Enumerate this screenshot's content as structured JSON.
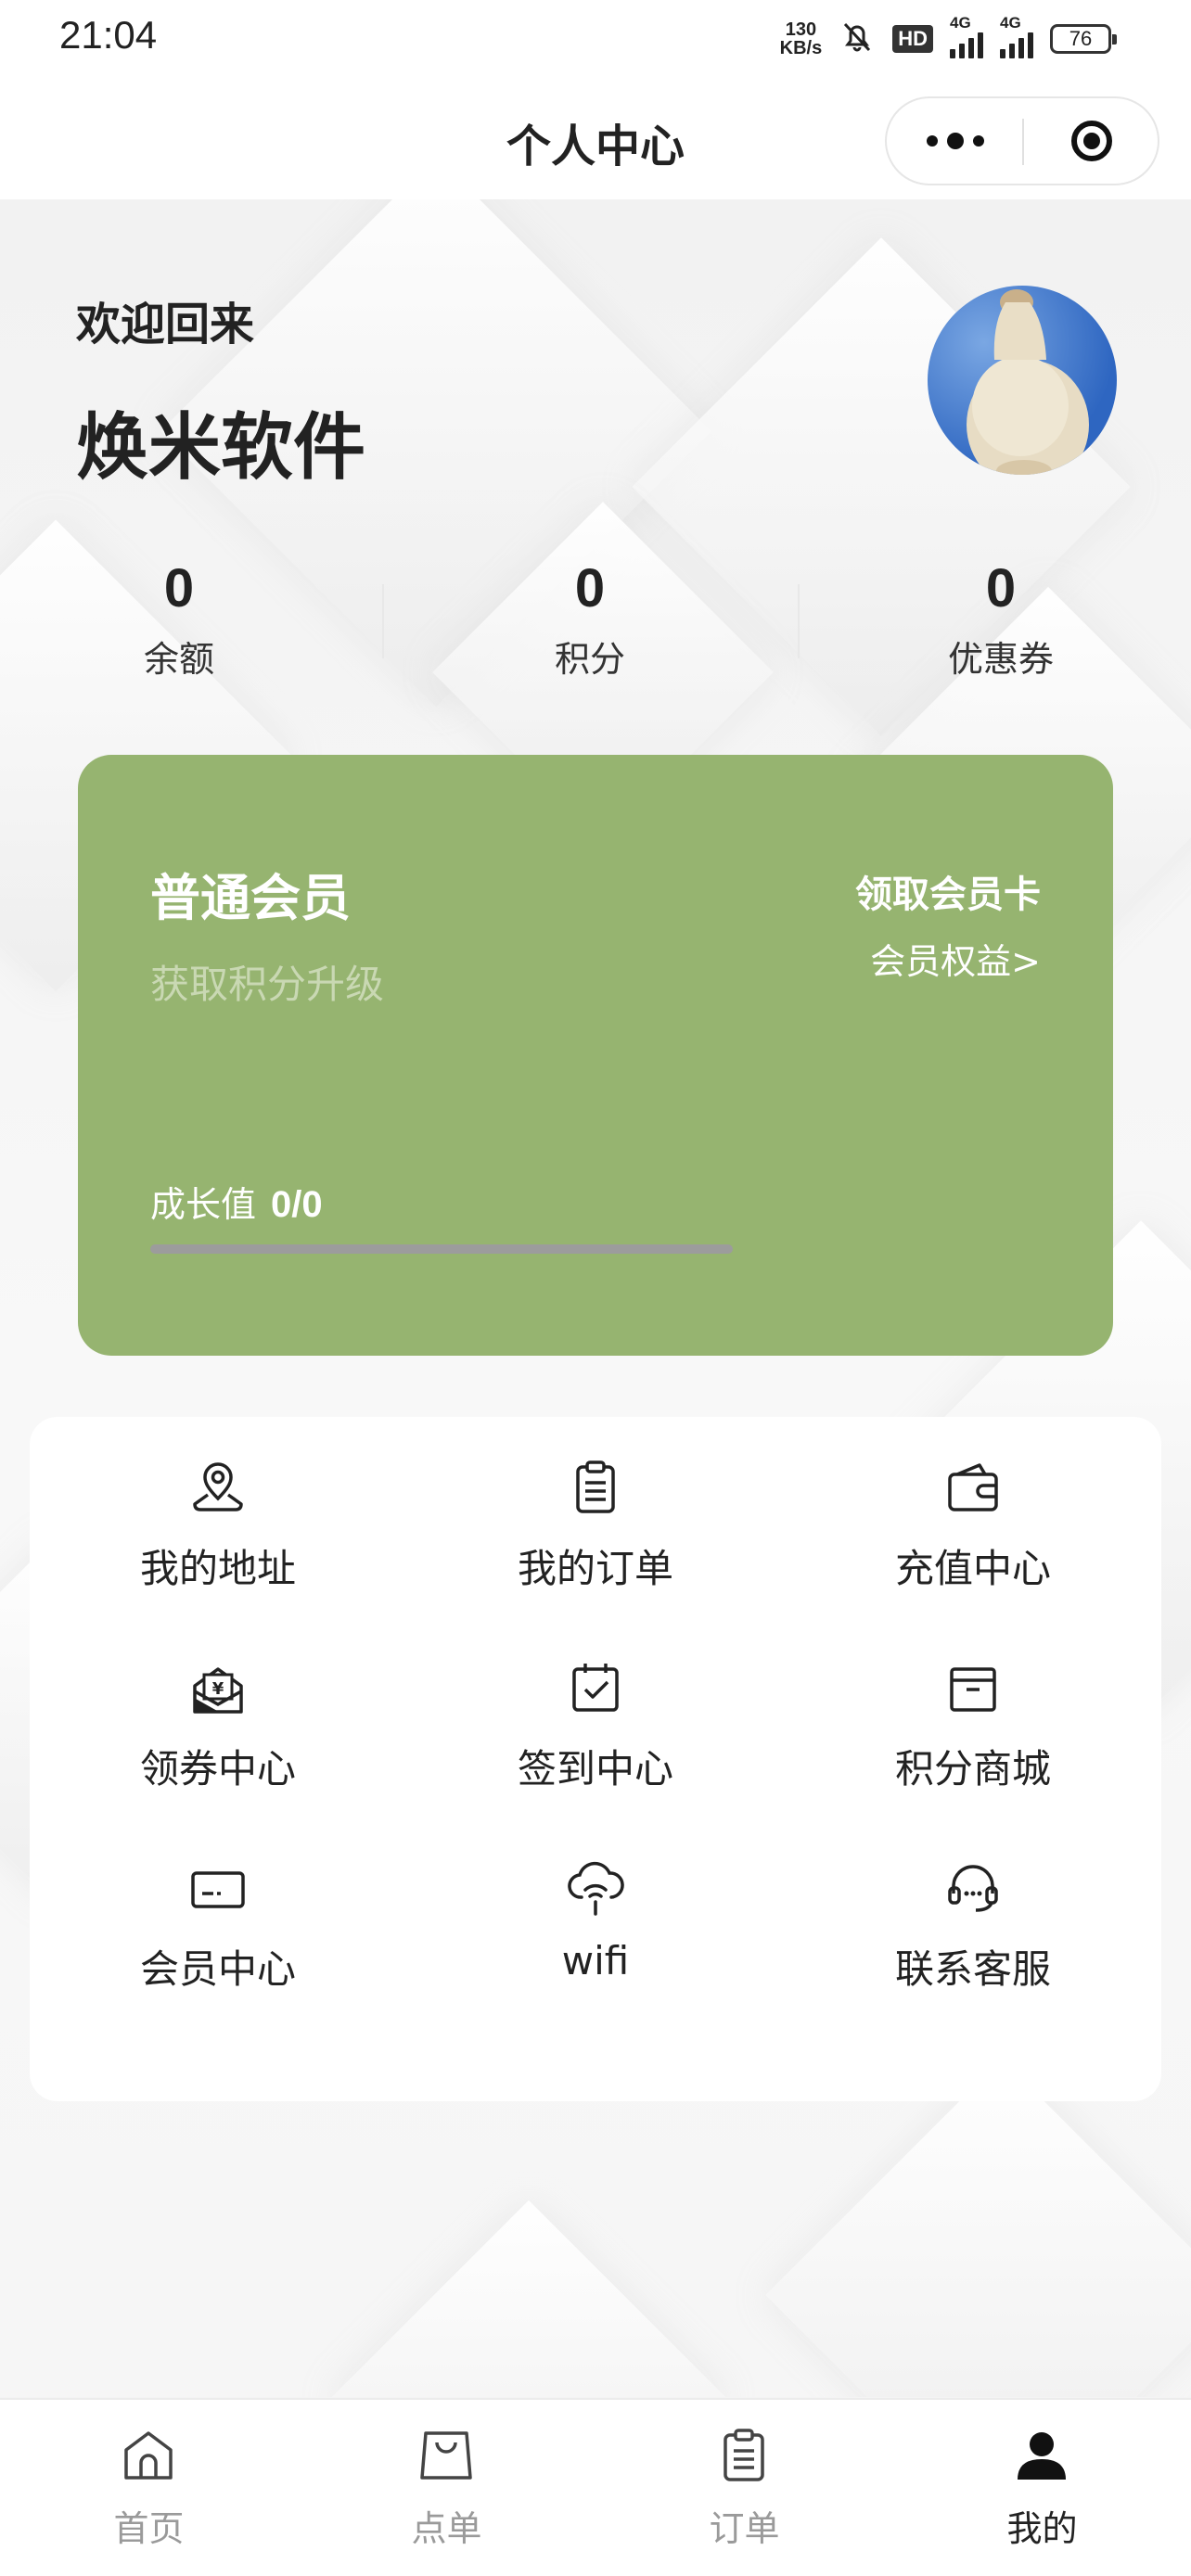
{
  "status_bar": {
    "time": "21:04",
    "net_speed_value": "130",
    "net_speed_unit": "KB/s",
    "hd_label": "HD",
    "signal_1": "4G",
    "signal_2": "4G",
    "battery": "76"
  },
  "header": {
    "title": "个人中心",
    "more_icon": "more-dots-icon",
    "close_icon": "miniprogram-close-icon"
  },
  "profile": {
    "welcome": "欢迎回来",
    "name": "焕米软件"
  },
  "stats": [
    {
      "value": "0",
      "label": "余额"
    },
    {
      "value": "0",
      "label": "积分"
    },
    {
      "value": "0",
      "label": "优惠券"
    }
  ],
  "member_card": {
    "level": "普通会员",
    "hint": "获取积分升级",
    "claim": "领取会员卡",
    "benefits": "会员权益>",
    "growth_label": "成长值",
    "growth_value": "0/0",
    "growth_progress": 0,
    "color": "#96b470"
  },
  "menu": [
    {
      "label": "我的地址",
      "icon": "location-icon"
    },
    {
      "label": "我的订单",
      "icon": "clipboard-icon"
    },
    {
      "label": "充值中心",
      "icon": "wallet-icon"
    },
    {
      "label": "领券中心",
      "icon": "coupon-envelope-icon"
    },
    {
      "label": "签到中心",
      "icon": "calendar-check-icon"
    },
    {
      "label": "积分商城",
      "icon": "box-icon"
    },
    {
      "label": "会员中心",
      "icon": "card-icon"
    },
    {
      "label": "wifi",
      "icon": "wifi-cloud-icon"
    },
    {
      "label": "联系客服",
      "icon": "headset-icon"
    }
  ],
  "tabs": [
    {
      "label": "首页",
      "icon": "home-icon",
      "active": false
    },
    {
      "label": "点单",
      "icon": "bag-icon",
      "active": false
    },
    {
      "label": "订单",
      "icon": "clipboard-icon",
      "active": false
    },
    {
      "label": "我的",
      "icon": "user-icon",
      "active": true
    }
  ]
}
